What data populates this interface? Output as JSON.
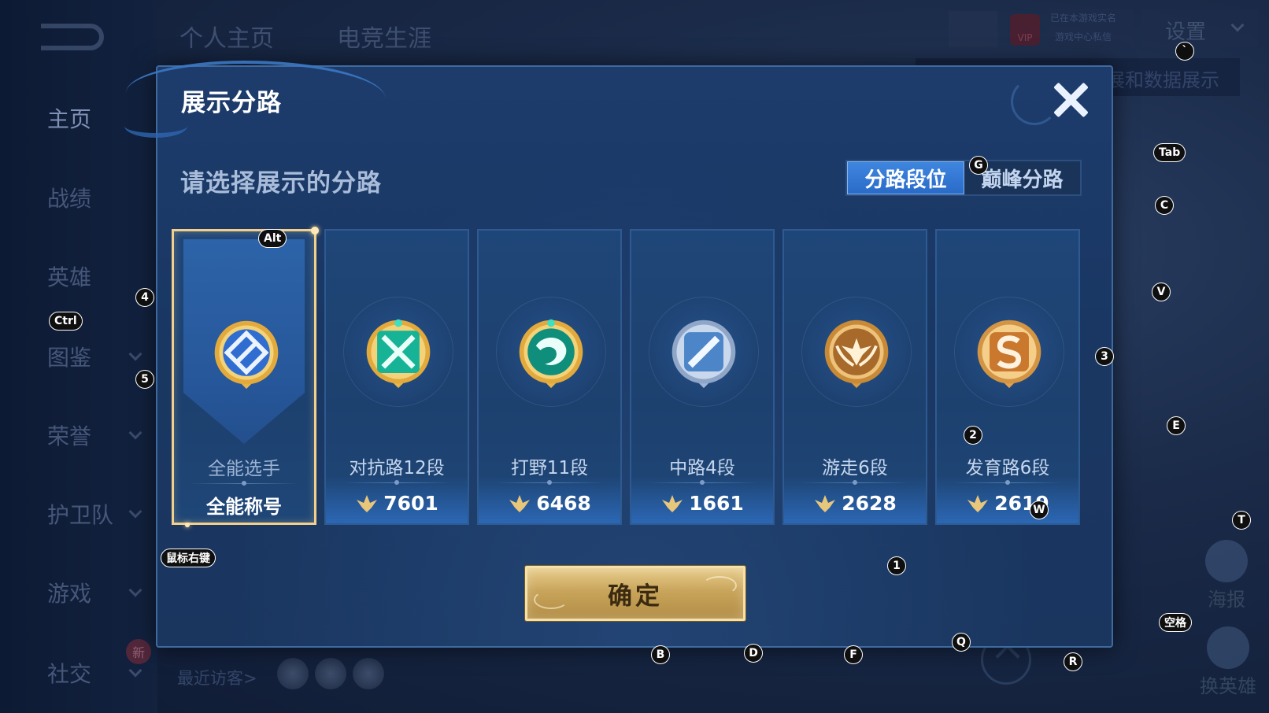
{
  "background": {
    "top_tabs": [
      "个人主页",
      "电竞生涯"
    ],
    "sidebar": [
      {
        "label": "主页",
        "active": true
      },
      {
        "label": "战绩"
      },
      {
        "label": "英雄"
      },
      {
        "label": "图鉴",
        "chevron": true
      },
      {
        "label": "荣誉",
        "chevron": true
      },
      {
        "label": "护卫队",
        "chevron": true
      },
      {
        "label": "游戏",
        "chevron": true
      },
      {
        "label": "社交",
        "chevron": true
      }
    ],
    "new_badge": "新",
    "settings_label": "设置",
    "vip_label": "VIP",
    "status_line1": "已在本游戏实名",
    "status_line2": "游戏中心私信",
    "banner_text": "展和数据展示",
    "recent_visitors_label": "最近访客>",
    "right_buttons": [
      {
        "label": "海报"
      },
      {
        "label": "换英雄"
      }
    ]
  },
  "dialog": {
    "title": "展示分路",
    "prompt": "请选择展示的分路",
    "tabs": [
      {
        "label": "分路段位",
        "active": true
      },
      {
        "label": "巅峰分路",
        "active": false
      }
    ],
    "cards": [
      {
        "name": "全能选手",
        "bottom_text": "全能称号",
        "selected": true,
        "emblem": "all-round-emblem-icon",
        "color": "#3d7fd8"
      },
      {
        "name": "对抗路12段",
        "score": "7601",
        "emblem": "clash-lane-emblem-icon",
        "color": "#1fb9a0"
      },
      {
        "name": "打野11段",
        "score": "6468",
        "emblem": "jungle-emblem-icon",
        "color": "#16a48c"
      },
      {
        "name": "中路4段",
        "score": "1661",
        "emblem": "mid-lane-emblem-icon",
        "color": "#7fa8d8"
      },
      {
        "name": "游走6段",
        "score": "2628",
        "emblem": "roam-emblem-icon",
        "color": "#d89a45"
      },
      {
        "name": "发育路6段",
        "score": "2619",
        "emblem": "farm-lane-emblem-icon",
        "color": "#e0a050"
      }
    ],
    "confirm_label": "确定"
  },
  "hotkeys": [
    {
      "label": "Alt"
    },
    {
      "label": "Ctrl"
    },
    {
      "label": "鼠标右键"
    },
    {
      "label": "4"
    },
    {
      "label": "5"
    },
    {
      "label": "G"
    },
    {
      "label": "Tab"
    },
    {
      "label": "C"
    },
    {
      "label": "V"
    },
    {
      "label": "3"
    },
    {
      "label": "E"
    },
    {
      "label": "2"
    },
    {
      "label": "W"
    },
    {
      "label": "T"
    },
    {
      "label": "1"
    },
    {
      "label": "空格"
    },
    {
      "label": "Q"
    },
    {
      "label": "R"
    },
    {
      "label": "B"
    },
    {
      "label": "D"
    },
    {
      "label": "F"
    },
    {
      "label": "`"
    }
  ]
}
